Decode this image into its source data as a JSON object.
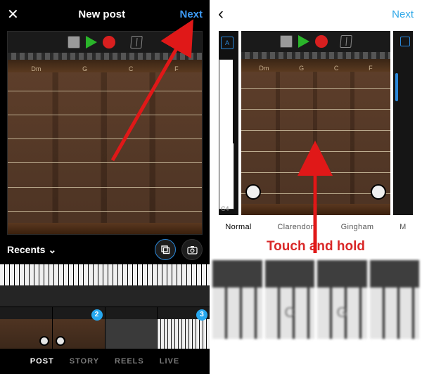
{
  "left": {
    "title": "New post",
    "next": "Next",
    "close_glyph": "✕",
    "controls": {
      "stop": "stop",
      "play": "play",
      "record": "record",
      "metronome": "metronome"
    },
    "chords": [
      "Dm",
      "G",
      "C",
      "F"
    ],
    "album_label": "Recents",
    "multi_icon": "multi",
    "camera_icon": "camera",
    "badges": [
      "2",
      "3"
    ],
    "modes": [
      "POST",
      "STORY",
      "REELS",
      "LIVE"
    ],
    "active_mode": "POST"
  },
  "right": {
    "back_glyph": "‹",
    "next": "Next",
    "key_label": "C4",
    "tuner": "A",
    "chords": [
      "Dm",
      "G",
      "C",
      "F"
    ],
    "filters": [
      "Normal",
      "Clarendon",
      "Gingham",
      "M"
    ],
    "selected_filter": "Normal",
    "annotation": "Touch and hold",
    "thumb_letters": [
      "",
      "C",
      "G",
      ""
    ]
  }
}
